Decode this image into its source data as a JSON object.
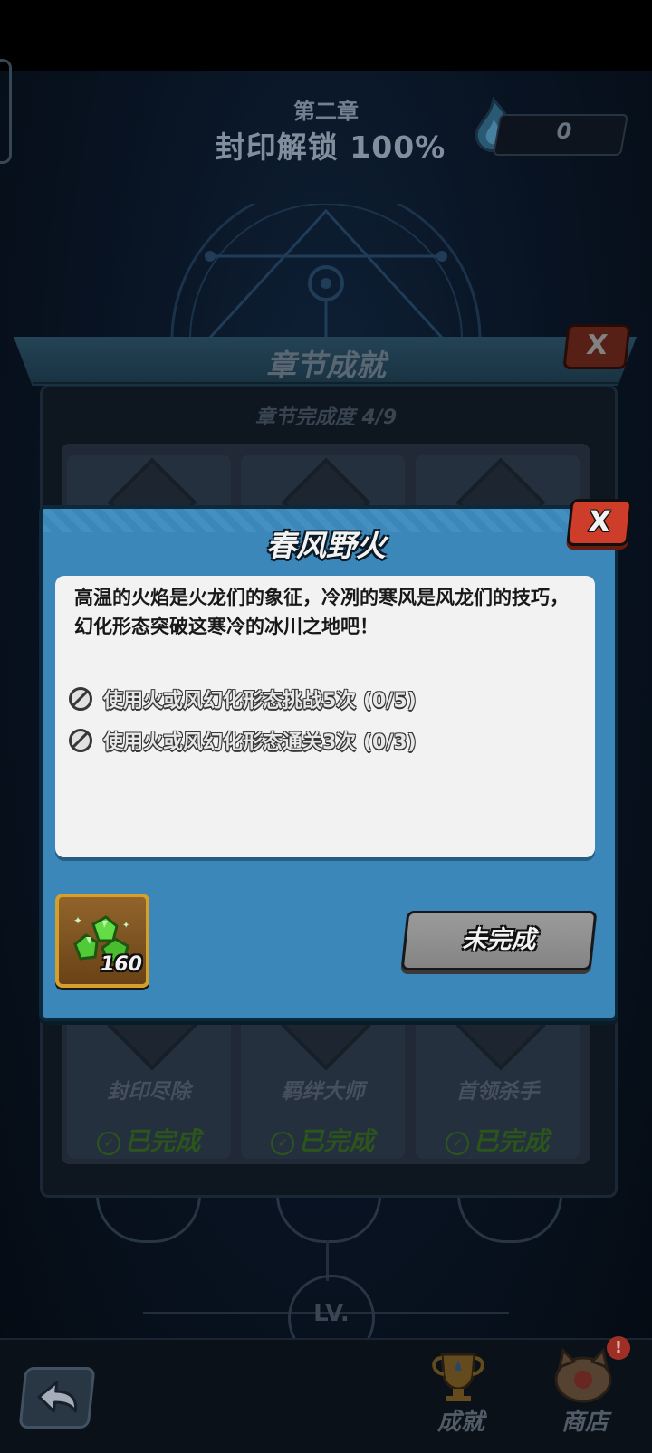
{
  "header": {
    "chapter_label": "第二章",
    "chapter_title": "封印解锁 100%",
    "currency_value": "0"
  },
  "achievements_panel": {
    "title": "章节成就",
    "progress": "章节完成度 4/9",
    "close_label": "X",
    "items": [
      {
        "name": "封印尽除",
        "status": "已完成"
      },
      {
        "name": "羁绊大师",
        "status": "已完成"
      },
      {
        "name": "首领杀手",
        "status": "已完成"
      }
    ]
  },
  "dialog": {
    "title": "春风野火",
    "close_label": "X",
    "description": "高温的火焰是火龙们的象征，冷冽的寒风是风龙们的技巧，幻化形态突破这寒冷的冰川之地吧！",
    "tasks": [
      {
        "text": "使用火或风幻化形态挑战5次 (0/5)"
      },
      {
        "text": "使用火或风幻化形态通关3次 (0/3)"
      }
    ],
    "reward": {
      "icon": "green-gem-icon",
      "count": "160"
    },
    "status_button": "未完成"
  },
  "map": {
    "level_node": "LV."
  },
  "bottom_nav": {
    "back_icon": "back-arrow-icon",
    "achievements_label": "成就",
    "shop_label": "商店",
    "shop_badge": "!"
  },
  "colors": {
    "dialog_blue": "#3f8fc3",
    "close_red": "#d9412c",
    "reward_gold": "#e0a82e",
    "done_green": "#2f5a1e"
  }
}
